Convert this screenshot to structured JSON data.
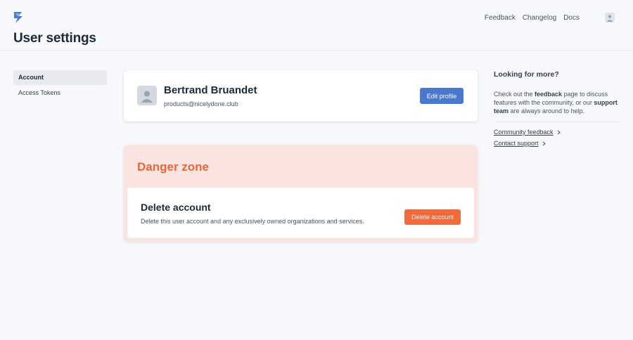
{
  "app": {
    "page_title": "User settings",
    "logo_icon": "bolt-logo-icon",
    "accent_color": "#4a78d1",
    "danger_color": "#f26a3c"
  },
  "topnav": {
    "links": [
      "Feedback",
      "Changelog",
      "Docs"
    ],
    "avatar_icon": "user-avatar-icon"
  },
  "sidebar": {
    "items": [
      {
        "label": "Account",
        "active": true
      },
      {
        "label": "Access Tokens",
        "active": false
      }
    ]
  },
  "profile": {
    "name": "Bertrand Bruandet",
    "email": "products@nicelydone.club",
    "edit_label": "Edit profile"
  },
  "danger": {
    "title": "Danger zone",
    "delete_title": "Delete account",
    "delete_desc": "Delete this user account and any exclusively owned organizations and services.",
    "delete_label": "Delete account"
  },
  "aside": {
    "title": "Looking for more?",
    "text_1": "Check out the ",
    "text_feedback": "feedback",
    "text_2": " page to discuss features with the community, or our ",
    "text_support": "support team",
    "text_3": " are always around to help.",
    "links": [
      "Community feedback",
      "Contact support"
    ]
  }
}
